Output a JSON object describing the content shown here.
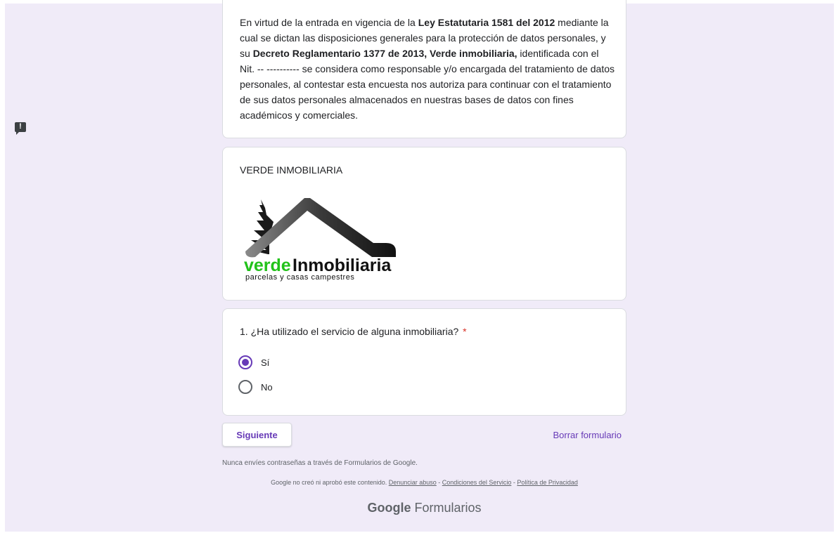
{
  "description": {
    "p1": "En virtud de la entrada en vigencia de la ",
    "b1": "Ley Estatutaria 1581 del 2012",
    "p2": " mediante la cual se dictan las disposiciones generales para la protección de datos personales, y su ",
    "b2": "Decreto Reglamentario 1377 de 2013, Verde inmobiliaria,",
    "p3": " identificada con el Nit. -- ---------- se considera como responsable y/o encargada del tratamiento de datos personales, al contestar esta encuesta nos autoriza para continuar con el tratamiento de sus datos personales almacenados en nuestras bases de datos con fines académicos y comerciales."
  },
  "image_card": {
    "title": "VERDE INMOBILIARIA",
    "logo_word1": "verde",
    "logo_word2": "Inmobiliaria",
    "logo_tagline": "parcelas y casas campestres"
  },
  "question": {
    "title": "1. ¿Ha utilizado el servicio de alguna inmobiliaria?",
    "required_mark": "*",
    "options": [
      {
        "label": "Sí",
        "selected": true
      },
      {
        "label": "No",
        "selected": false
      }
    ]
  },
  "actions": {
    "next_label": "Siguiente",
    "clear_label": "Borrar formulario"
  },
  "footer": {
    "warning": "Nunca envíes contraseñas a través de Formularios de Google.",
    "disclaimer": "Google no creó ni aprobó este contenido.",
    "report_abuse": "Denunciar abuso",
    "terms": "Condiciones del Servicio",
    "privacy": "Política de Privacidad",
    "sep": " - ",
    "brand_google": "Google",
    "brand_product": "Formularios"
  },
  "colors": {
    "accent": "#673ab7",
    "background": "#f0ebf8",
    "required": "#d93025"
  }
}
